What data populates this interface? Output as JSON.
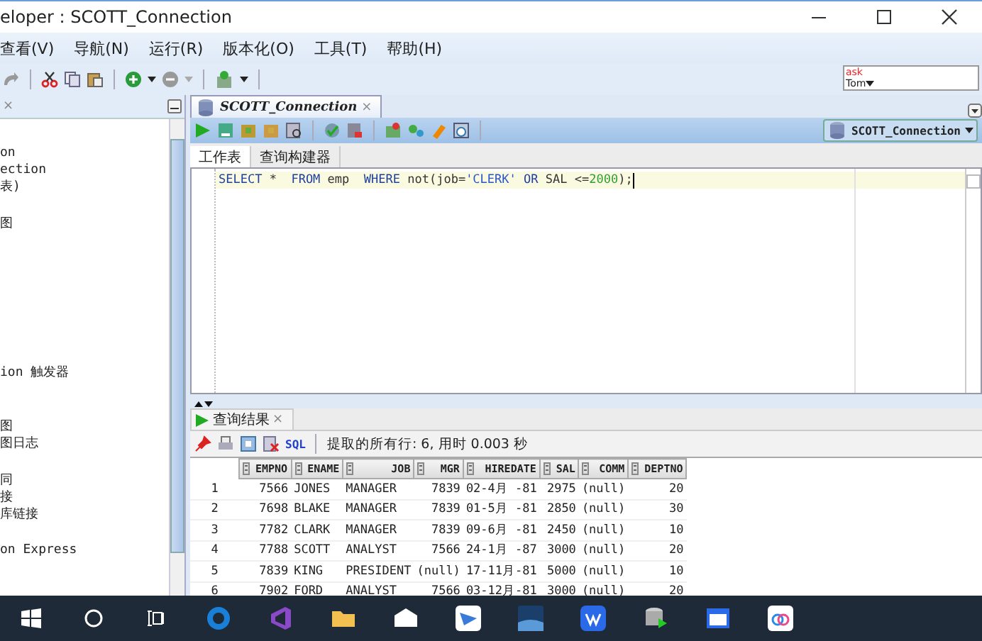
{
  "window": {
    "title": "eloper : SCOTT_Connection"
  },
  "menu": [
    "查看(V)",
    "导航(N)",
    "运行(R)",
    "版本化(O)",
    "工具(T)",
    "帮助(H)"
  ],
  "ask_box": {
    "top": "ask",
    "bottom": "Tom"
  },
  "left_panel": {
    "close": "×",
    "groups": [
      [
        "on",
        "ection",
        "表)"
      ],
      [
        "图"
      ],
      [
        "ion 触发器"
      ],
      [
        "图",
        "图日志"
      ],
      [
        "同",
        "接",
        "库链接"
      ],
      [
        "on Express"
      ]
    ]
  },
  "editor_tab": {
    "label": "SCOTT_Connection",
    "close": "×",
    "selected": true
  },
  "connection_select": "SCOTT_Connection",
  "sub_tabs": [
    {
      "label": "工作表",
      "selected": true
    },
    {
      "label": "查询构建器",
      "selected": false
    }
  ],
  "sql": [
    {
      "kind": "keyword",
      "text": "SELECT"
    },
    {
      "kind": "plain",
      "text": " *  "
    },
    {
      "kind": "keyword",
      "text": "FROM"
    },
    {
      "kind": "plain",
      "text": " emp  "
    },
    {
      "kind": "keyword",
      "text": "WHERE"
    },
    {
      "kind": "plain",
      "text": " not(job="
    },
    {
      "kind": "string",
      "text": "'CLERK' "
    },
    {
      "kind": "keyword",
      "text": "OR"
    },
    {
      "kind": "plain",
      "text": " SAL <="
    },
    {
      "kind": "number",
      "text": "2000"
    },
    {
      "kind": "plain",
      "text": ");"
    }
  ],
  "results_tab": {
    "label": "查询结果",
    "close": "×"
  },
  "results_toolbar": {
    "sql_link": "SQL",
    "status": "提取的所有行: 6, 用时 0.003 秒"
  },
  "table": {
    "columns": [
      "EMPNO",
      "ENAME",
      "JOB",
      "MGR",
      "HIREDATE",
      "SAL",
      "COMM",
      "DEPTNO"
    ],
    "rows": [
      {
        "row_number": "1",
        "cells": [
          "7566",
          "JONES",
          "MANAGER",
          "7839",
          "02-4月 -81",
          "2975",
          "(null)",
          "20"
        ]
      },
      {
        "row_number": "2",
        "cells": [
          "7698",
          "BLAKE",
          "MANAGER",
          "7839",
          "01-5月 -81",
          "2850",
          "(null)",
          "30"
        ]
      },
      {
        "row_number": "3",
        "cells": [
          "7782",
          "CLARK",
          "MANAGER",
          "7839",
          "09-6月 -81",
          "2450",
          "(null)",
          "10"
        ]
      },
      {
        "row_number": "4",
        "cells": [
          "7788",
          "SCOTT",
          "ANALYST",
          "7566",
          "24-1月 -87",
          "3000",
          "(null)",
          "20"
        ]
      },
      {
        "row_number": "5",
        "cells": [
          "7839",
          "KING",
          "PRESIDENT",
          "(null)",
          "17-11月-81",
          "5000",
          "(null)",
          "10"
        ]
      },
      {
        "row_number": "6",
        "cells": [
          "7902",
          "FORD",
          "ANALYST",
          "7566",
          "03-12月-81",
          "3000",
          "(null)",
          "20"
        ]
      }
    ]
  }
}
